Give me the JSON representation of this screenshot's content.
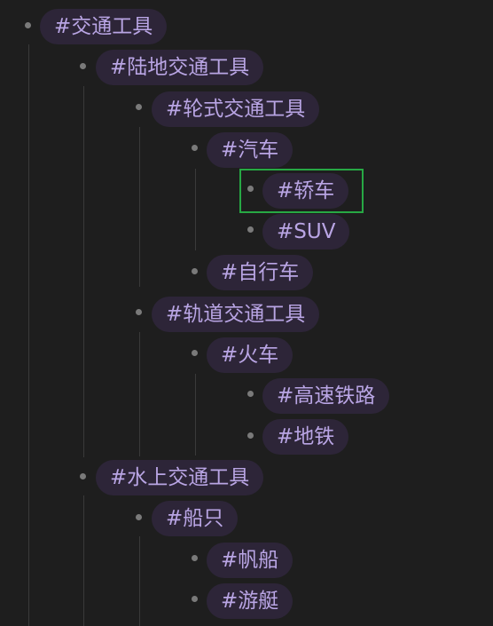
{
  "tree": {
    "root": {
      "label": "#交通工具"
    },
    "land": {
      "label": "#陆地交通工具"
    },
    "wheeled": {
      "label": "#轮式交通工具"
    },
    "car": {
      "label": "#汽车"
    },
    "sedan": {
      "label": "#轿车",
      "selected": true
    },
    "suv": {
      "label": "#SUV"
    },
    "bicycle": {
      "label": "#自行车"
    },
    "rail": {
      "label": "#轨道交通工具"
    },
    "train": {
      "label": "#火车"
    },
    "highspeed": {
      "label": "#高速铁路"
    },
    "subway": {
      "label": "#地铁"
    },
    "water": {
      "label": "#水上交通工具"
    },
    "ship": {
      "label": "#船只"
    },
    "sailboat": {
      "label": "#帆船"
    },
    "yacht": {
      "label": "#游艇"
    }
  },
  "colors": {
    "background": "#1e1e1e",
    "tag_background": "#2d2538",
    "tag_text": "#b9a5e4",
    "bullet": "#7a7a7a",
    "guide_line": "#3a3a3a",
    "selection_border": "#27a844"
  }
}
